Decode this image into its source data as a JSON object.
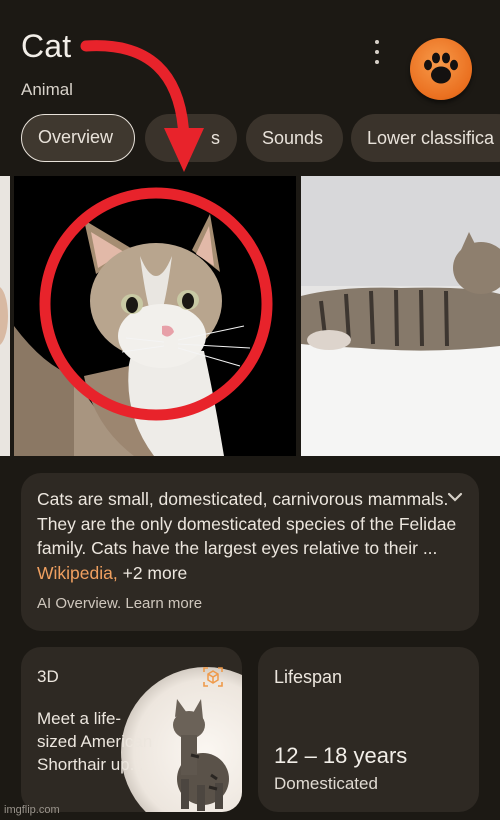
{
  "header": {
    "title": "Cat",
    "subtitle": "Animal"
  },
  "tabs": [
    {
      "label": "Overview",
      "active": true
    },
    {
      "label": "Breeds",
      "visible_fragment": "s"
    },
    {
      "label": "Sounds",
      "active": false
    },
    {
      "label": "Lower classifica",
      "active": false
    }
  ],
  "summary": {
    "text": "Cats are small, domesticated, carnivorous mammals. They are the only domesticated species of the Felidae family. Cats have the largest eyes relative to their ...",
    "source_link": "Wikipedia,",
    "more_link": "+2 more",
    "footer": "AI Overview. Learn more"
  },
  "card_3d": {
    "title": "3D",
    "text": "Meet a life-sized American Shorthair up..."
  },
  "card_lifespan": {
    "title": "Lifespan",
    "value": "12 – 18 years",
    "note": "Domesticated"
  },
  "watermark": "imgflip.com",
  "colors": {
    "background": "#1c1914",
    "card": "#2e2923",
    "chip": "#3a332b",
    "link": "#f0a060",
    "annotation_red": "#e8232b",
    "badge_orange": "#ea6f1f"
  },
  "icons": [
    "more-vert-icon",
    "paw-icon",
    "chevron-down-icon",
    "3d-cube-icon",
    "annotation-arrow",
    "annotation-circle"
  ]
}
